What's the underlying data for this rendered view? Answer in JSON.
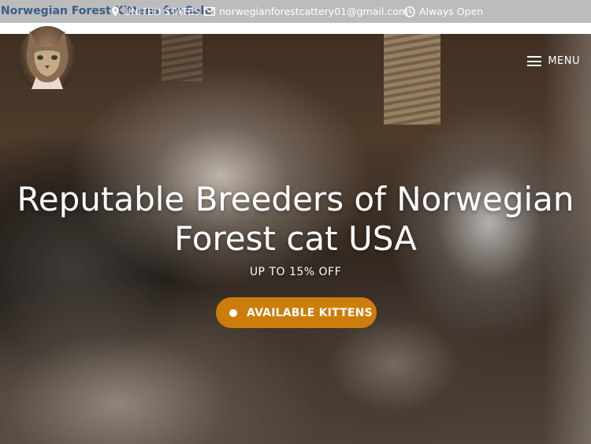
{
  "topbar": {
    "site_title": "Norwegian Forest Kittens for Sale",
    "location": "UNITED STATES",
    "email": "norwegianforestcattery01@gmail.com",
    "hours": "Always Open"
  },
  "header": {
    "menu_label": "MENU"
  },
  "hero": {
    "headline_line1": "Reputable Breeders of Norwegian",
    "headline_line2": "Forest cat USA",
    "subheadline": "UP TO 15% OFF",
    "cta_label": "AVAILABLE KITTENS"
  },
  "colors": {
    "topbar_bg": "#bdbcbc",
    "title_color": "#3a5f87",
    "cta_bg": "#cc7d0c"
  },
  "icons": [
    "map-pin-icon",
    "envelope-icon",
    "clock-icon",
    "hamburger-icon"
  ]
}
